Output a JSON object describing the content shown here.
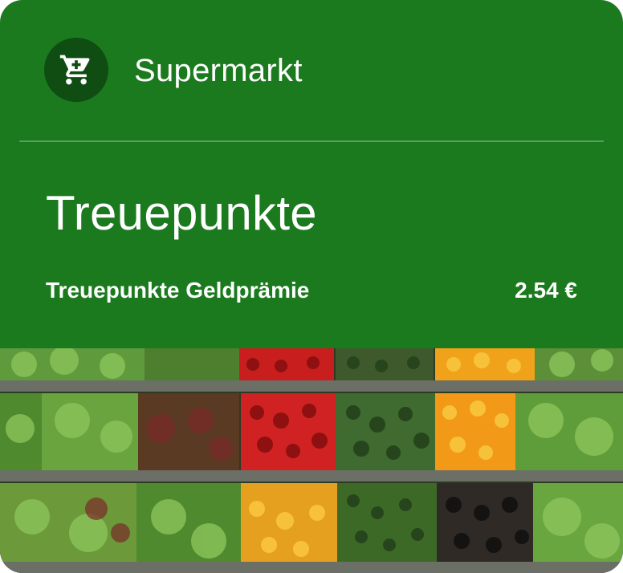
{
  "card": {
    "merchant_name": "Supermarkt",
    "logo_icon": "shopping-cart-icon",
    "program_title": "Treuepunkte",
    "balance_label": "Treuepunkte Geldprämie",
    "balance_value": "2.54 €",
    "hero_image": "produce-shelves"
  },
  "colors": {
    "card_background": "#1b7a1e",
    "logo_background": "#0f4d12",
    "text": "#ffffff"
  }
}
